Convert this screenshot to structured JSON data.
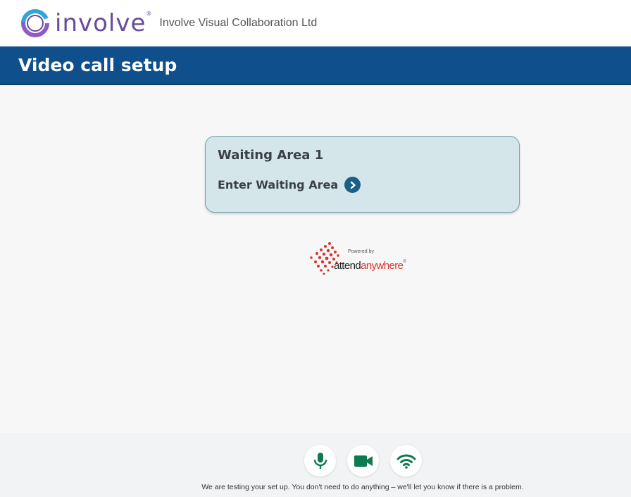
{
  "header": {
    "logo_text": "involve",
    "logo_trademark": "®",
    "organisation": "Involve Visual Collaboration Ltd",
    "logo_colors": [
      "#6a4a9a",
      "#2fa6d8",
      "#8c5cc4"
    ]
  },
  "title_bar": {
    "title": "Video call setup",
    "background": "#0e4f8c"
  },
  "waiting_area": {
    "name": "Waiting Area 1",
    "link_label": "Enter Waiting Area",
    "link_icon": "chevron-right-circle-icon"
  },
  "powered_by": {
    "label": "Powered by",
    "brand_part1": "attend",
    "brand_part2": "anywhere",
    "brand_trademark": "®",
    "brand_color": "#e0322c"
  },
  "setup_test": {
    "icons": [
      "microphone-icon",
      "video-camera-icon",
      "wifi-icon"
    ],
    "icon_color": "#0e7a4f",
    "message": "We are testing your set up. You don't need to do anything – we'll let you know if there is a problem."
  }
}
